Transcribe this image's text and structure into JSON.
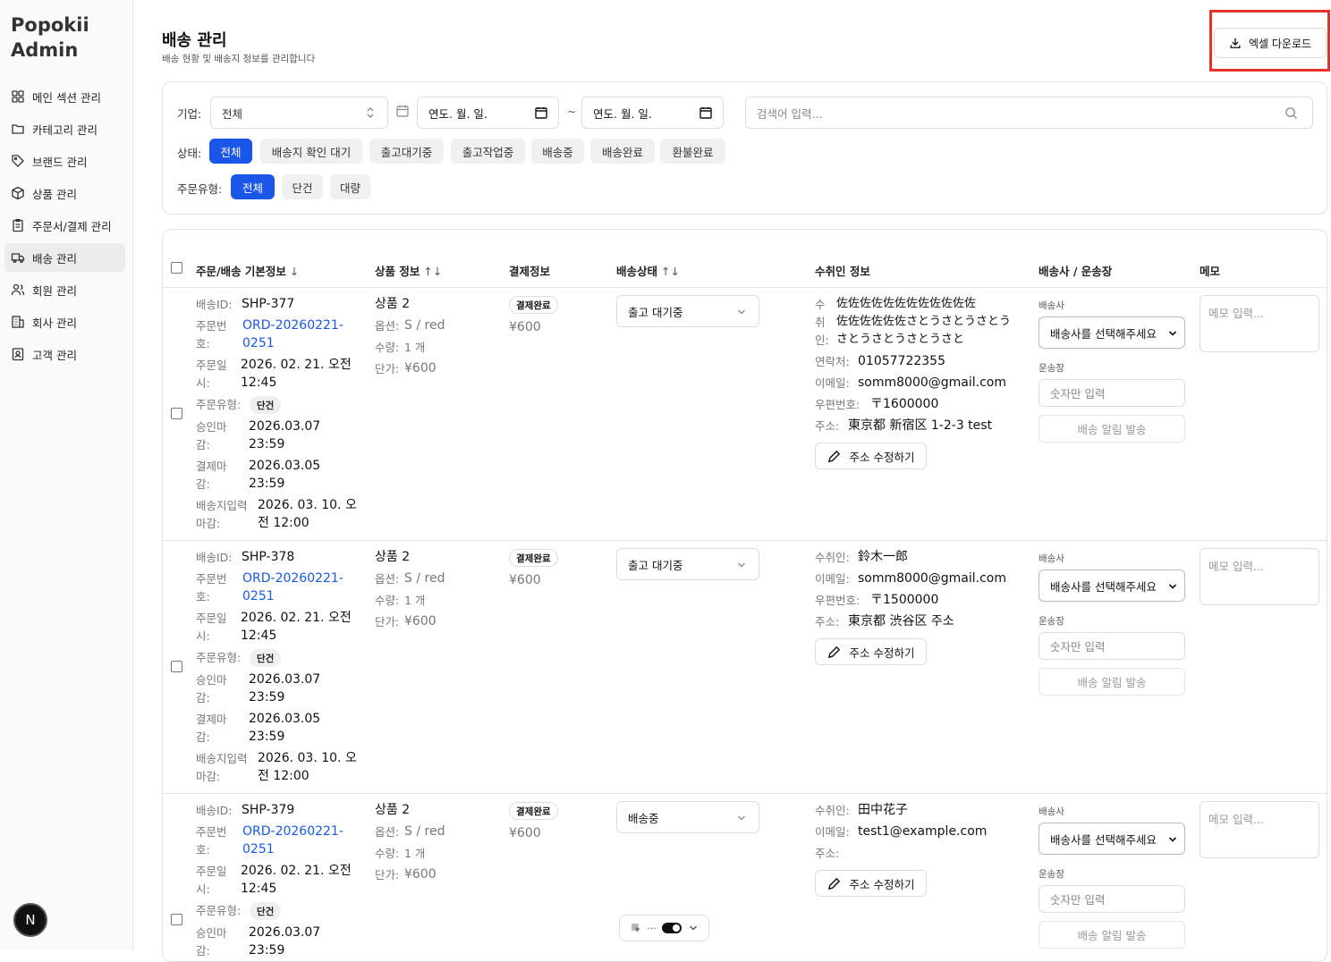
{
  "app": {
    "title": "Popokii Admin"
  },
  "sidebar": {
    "items": [
      {
        "label": "메인 섹션 관리",
        "icon": "grid-icon"
      },
      {
        "label": "카테고리 관리",
        "icon": "folder-icon"
      },
      {
        "label": "브랜드 관리",
        "icon": "tag-icon"
      },
      {
        "label": "상품 관리",
        "icon": "box-icon"
      },
      {
        "label": "주문서/결제 관리",
        "icon": "clipboard-icon"
      },
      {
        "label": "배송 관리",
        "icon": "truck-icon",
        "active": true
      },
      {
        "label": "회원 관리",
        "icon": "users-icon"
      },
      {
        "label": "회사 관리",
        "icon": "building-icon"
      },
      {
        "label": "고객 관리",
        "icon": "contact-icon"
      }
    ],
    "badge": "N"
  },
  "header": {
    "title": "배송 관리",
    "subtitle": "배송 현황 및 배송지 정보를 관리합니다",
    "download_label": "엑셀 다운로드"
  },
  "filters": {
    "company_label": "기업:",
    "company_value": "전체",
    "date_from": "연도. 월. 일.",
    "date_to": "연도. 월. 일.",
    "tilde": "~",
    "search_placeholder": "검색어 입력...",
    "status_label": "상태:",
    "statuses": [
      "전체",
      "배송지 확인 대기",
      "출고대기중",
      "출고작업중",
      "배송중",
      "배송완료",
      "환불완료"
    ],
    "type_label": "주문유형:",
    "types": [
      "전체",
      "단건",
      "대량"
    ]
  },
  "table": {
    "headers": {
      "basic": "주문/배송 기본정보",
      "basic_arrow": "↓",
      "product": "상품 정보",
      "product_arrow": "↑↓",
      "payment": "결제정보",
      "status": "배송상태",
      "status_arrow": "↑↓",
      "recipient": "수취인 정보",
      "carrier": "배송사 / 운송장",
      "memo": "메모"
    },
    "labels": {
      "ship_id": "배송ID:",
      "order_no_1": "주문번",
      "order_no_2": "호:",
      "order_dt_1": "주문일",
      "order_dt_2": "시:",
      "order_type": "주문유형:",
      "approve_1": "승인마",
      "approve_2": "감:",
      "pay_1": "결제마",
      "pay_2": "감:",
      "addr_dl_1": "배송지입력",
      "addr_dl_2": "마감:",
      "option": "옵션:",
      "qty": "수량:",
      "unit_price": "단가:",
      "phone": "연락처:",
      "email": "이메일:",
      "zip": "우편번호:",
      "address": "주소:",
      "recipient": "수취인:",
      "recipient_wrapped": [
        "수",
        "취",
        "인:"
      ],
      "carrier": "배송사",
      "tracking": "운송장",
      "edit_address": "주소 수정하기",
      "carrier_placeholder": "배송사를 선택해주세요",
      "tracking_placeholder": "숫자만 입력",
      "notify": "배송 알림 발송",
      "memo_placeholder": "메모 입력..."
    },
    "rows": [
      {
        "ship_id": "SHP-377",
        "order_no_a": "ORD-20260221-",
        "order_no_b": "0251",
        "order_dt_a": "2026. 02. 21. 오전",
        "order_dt_b": "12:45",
        "order_type": "단건",
        "approve_a": "2026.03.07",
        "approve_b": "23:59",
        "pay_a": "2026.03.05",
        "pay_b": "23:59",
        "addr_a": "2026. 03. 10. 오",
        "addr_b": "전 12:00",
        "product": "상품 2",
        "option": "S / red",
        "qty": "1 개",
        "price": "¥600",
        "pay_status": "결제완료",
        "pay_amount": "¥600",
        "ship_status": "출고 대기중",
        "name_lines": [
          "佐佐佐佐佐佐佐佐佐佐佐佐",
          "佐佐佐佐佐佐さとうさとうさとう",
          "さとうさとうさとうさと"
        ],
        "phone": "01057722355",
        "email": "somm8000@gmail.com",
        "zip": "〒1600000",
        "address": "東京都 新宿区 1-2-3 test"
      },
      {
        "ship_id": "SHP-378",
        "order_no_a": "ORD-20260221-",
        "order_no_b": "0251",
        "order_dt_a": "2026. 02. 21. 오전",
        "order_dt_b": "12:45",
        "order_type": "단건",
        "approve_a": "2026.03.07",
        "approve_b": "23:59",
        "pay_a": "2026.03.05",
        "pay_b": "23:59",
        "addr_a": "2026. 03. 10. 오",
        "addr_b": "전 12:00",
        "product": "상품 2",
        "option": "S / red",
        "qty": "1 개",
        "price": "¥600",
        "pay_status": "결제완료",
        "pay_amount": "¥600",
        "ship_status": "출고 대기중",
        "name": "鈴木一郎",
        "email": "somm8000@gmail.com",
        "zip": "〒1500000",
        "address": "東京都 渋谷区 주소"
      },
      {
        "ship_id": "SHP-379",
        "order_no_a": "ORD-20260221-",
        "order_no_b": "0251",
        "order_dt_a": "2026. 02. 21. 오전",
        "order_dt_b": "12:45",
        "order_type": "단건",
        "approve_a": "2026.03.07",
        "approve_b": "23:59",
        "product": "상품 2",
        "option": "S / red",
        "qty": "1 개",
        "price": "¥600",
        "pay_status": "결제완료",
        "pay_amount": "¥600",
        "ship_status": "배송중",
        "name": "田中花子",
        "email": "test1@example.com",
        "address": ""
      }
    ]
  },
  "devtools": {
    "dots": "···"
  }
}
